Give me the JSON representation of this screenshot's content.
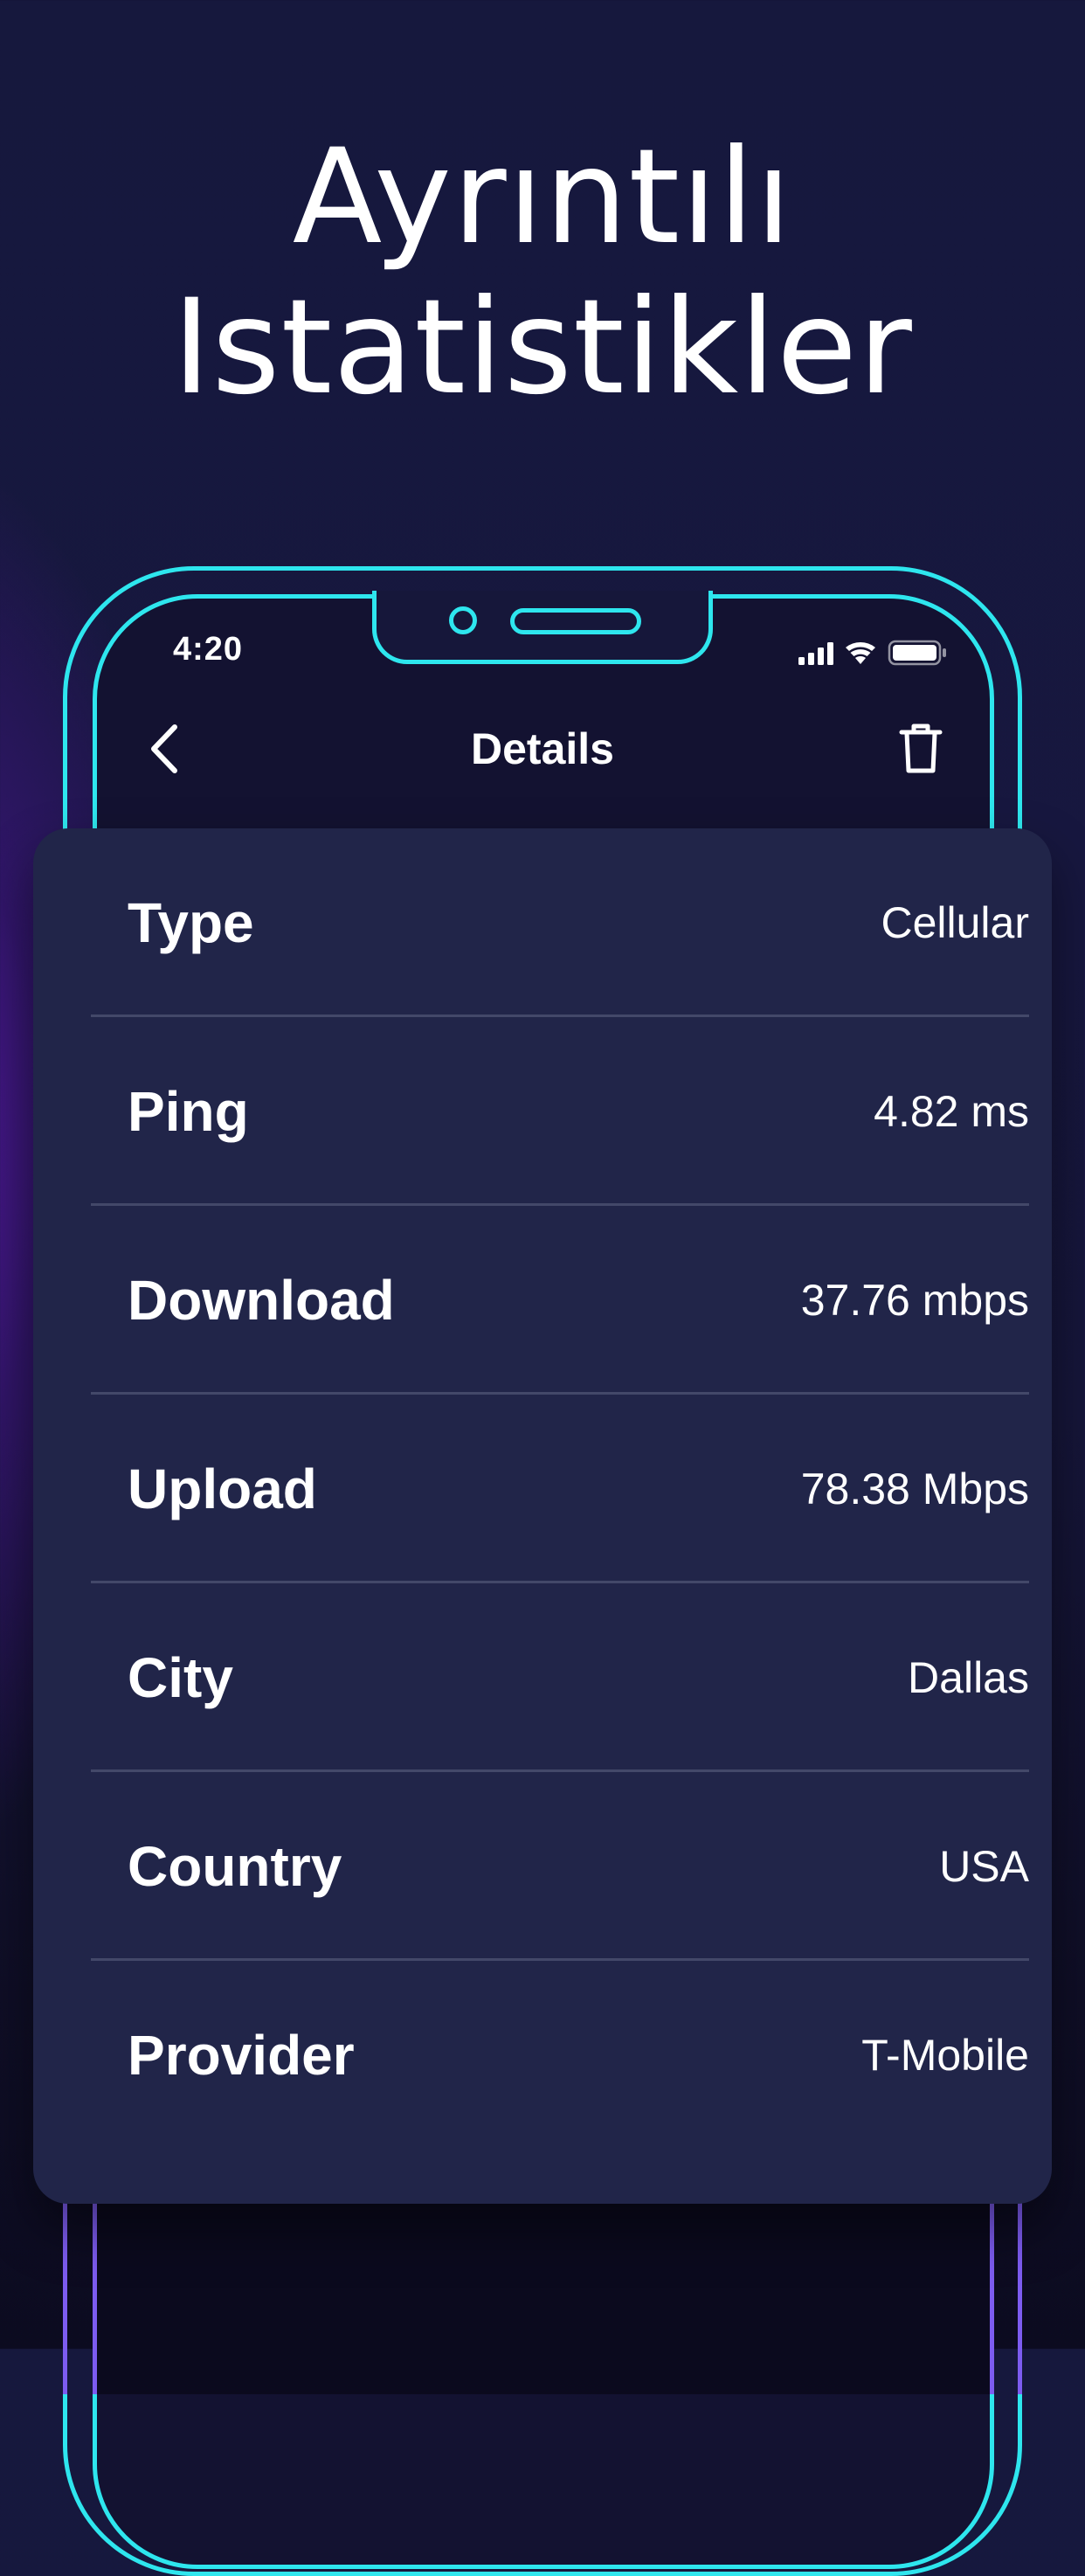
{
  "headline": {
    "line1": "Ayrıntılı",
    "line2": "Istatistikler"
  },
  "status_bar": {
    "time": "4:20",
    "icons": [
      "signal-icon",
      "wifi-icon",
      "battery-icon"
    ]
  },
  "nav": {
    "title": "Details",
    "back_icon": "chevron-left-icon",
    "delete_icon": "trash-icon"
  },
  "details": [
    {
      "label": "Type",
      "value": "Cellular"
    },
    {
      "label": "Ping",
      "value": "4.82 ms"
    },
    {
      "label": "Download",
      "value": "37.76 mbps"
    },
    {
      "label": "Upload",
      "value": "78.38 Mbps"
    },
    {
      "label": "City",
      "value": "Dallas"
    },
    {
      "label": "Country",
      "value": "USA"
    },
    {
      "label": "Provider",
      "value": "T-Mobile"
    }
  ],
  "colors": {
    "background": "#17173f",
    "accent_frame": "#2ee6ee",
    "card": "#212549",
    "divider": "#434869",
    "text": "#ffffff"
  }
}
